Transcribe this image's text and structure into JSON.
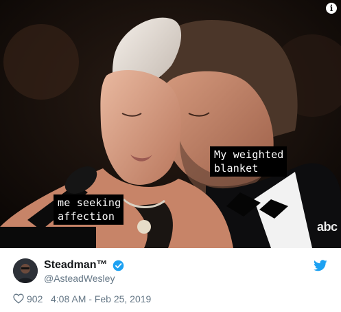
{
  "media": {
    "captions": {
      "right": "My weighted\nblanket",
      "left": "me seeking\naffection"
    },
    "watermark": "abc",
    "info_icon": "info-icon"
  },
  "author": {
    "display_name": "Steadman™",
    "handle": "@AsteadWesley",
    "verified": true,
    "avatar_icon": "avatar"
  },
  "footer": {
    "like_count": "902",
    "timestamp": "4:08 AM - Feb 25, 2019",
    "like_icon": "heart-icon"
  },
  "colors": {
    "accent": "#1da1f2",
    "text_primary": "#14171a",
    "text_secondary": "#657786",
    "caption_bg": "#000000",
    "caption_text": "#ffffff"
  }
}
